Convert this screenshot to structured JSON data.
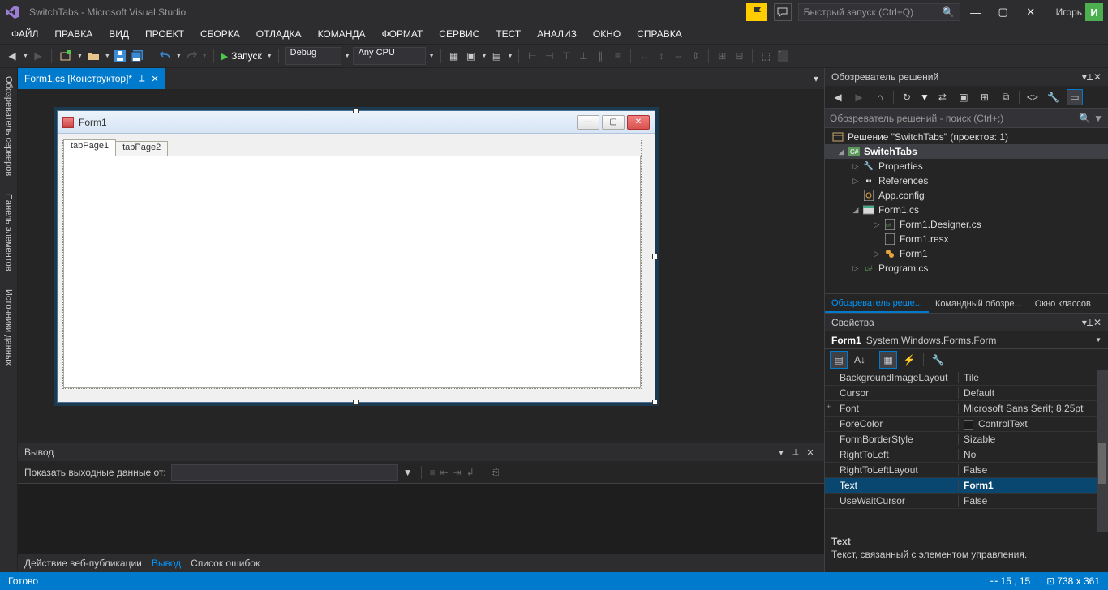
{
  "titlebar": {
    "title": "SwitchTabs - Microsoft Visual Studio",
    "quicklaunch_placeholder": "Быстрый запуск (Ctrl+Q)",
    "user_name": "Игорь",
    "avatar_initial": "И"
  },
  "menubar": [
    "ФАЙЛ",
    "ПРАВКА",
    "ВИД",
    "ПРОЕКТ",
    "СБОРКА",
    "ОТЛАДКА",
    "КОМАНДА",
    "ФОРМАТ",
    "СЕРВИС",
    "ТЕСТ",
    "АНАЛИЗ",
    "ОКНО",
    "СПРАВКА"
  ],
  "toolbar": {
    "start_label": "Запуск",
    "config": "Debug",
    "platform": "Any CPU"
  },
  "doc_tab": {
    "title": "Form1.cs [Конструктор]*"
  },
  "left_tabs": [
    "Обозреватель серверов",
    "Панель элементов",
    "Источники данных"
  ],
  "form": {
    "title": "Form1",
    "tab1": "tabPage1",
    "tab2": "tabPage2"
  },
  "output": {
    "title": "Вывод",
    "show_label": "Показать выходные данные от:",
    "bottom_tabs": {
      "a": "Действие веб-публикации",
      "b": "Вывод",
      "c": "Список ошибок"
    }
  },
  "se": {
    "title": "Обозреватель решений",
    "search_placeholder": "Обозреватель решений - поиск (Ctrl+;)",
    "solution": "Решение \"SwitchTabs\" (проектов: 1)",
    "project": "SwitchTabs",
    "nodes": {
      "properties": "Properties",
      "references": "References",
      "appconfig": "App.config",
      "form1cs": "Form1.cs",
      "form1designer": "Form1.Designer.cs",
      "form1resx": "Form1.resx",
      "form1class": "Form1",
      "programcs": "Program.cs"
    },
    "tabs": {
      "a": "Обозреватель реше...",
      "b": "Командный обозре...",
      "c": "Окно классов"
    }
  },
  "props": {
    "title": "Свойства",
    "obj_name": "Form1",
    "obj_type": "System.Windows.Forms.Form",
    "rows": [
      {
        "name": "BackgroundImageLayout",
        "value": "Tile"
      },
      {
        "name": "Cursor",
        "value": "Default"
      },
      {
        "name": "Font",
        "value": "Microsoft Sans Serif; 8,25pt",
        "exp": "+"
      },
      {
        "name": "ForeColor",
        "value": "ControlText",
        "color": "#1b1b1b"
      },
      {
        "name": "FormBorderStyle",
        "value": "Sizable"
      },
      {
        "name": "RightToLeft",
        "value": "No"
      },
      {
        "name": "RightToLeftLayout",
        "value": "False"
      },
      {
        "name": "Text",
        "value": "Form1",
        "sel": true,
        "bold": true
      },
      {
        "name": "UseWaitCursor",
        "value": "False"
      }
    ],
    "desc_name": "Text",
    "desc_text": "Текст, связанный с элементом управления."
  },
  "status": {
    "ready": "Готово",
    "pos": "15 , 15",
    "size": "738 x 361"
  }
}
